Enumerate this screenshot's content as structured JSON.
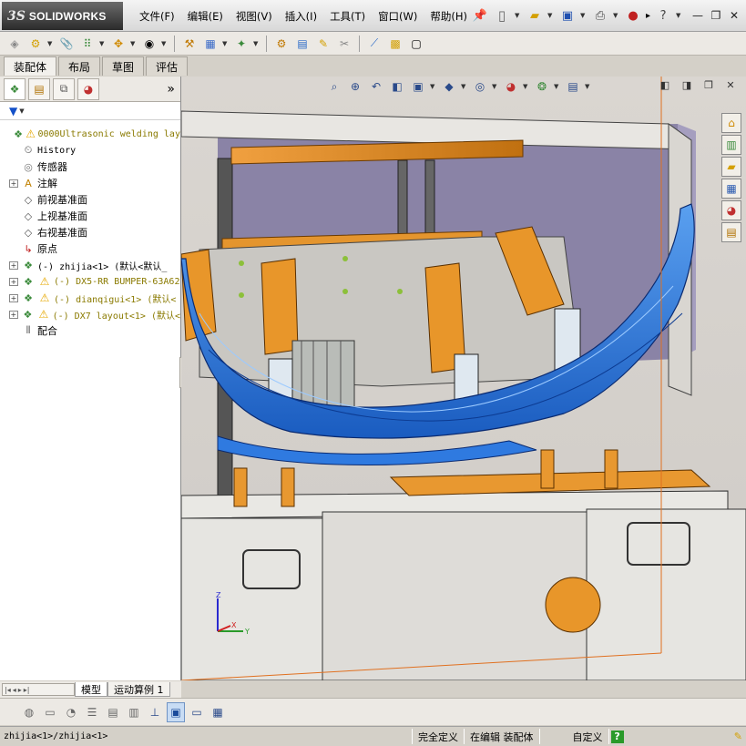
{
  "app": {
    "logo_prefix": "3S",
    "logo_name": "SOLIDWORKS"
  },
  "menu": [
    {
      "label": "文件(F)"
    },
    {
      "label": "编辑(E)"
    },
    {
      "label": "视图(V)"
    },
    {
      "label": "插入(I)"
    },
    {
      "label": "工具(T)"
    },
    {
      "label": "窗口(W)"
    },
    {
      "label": "帮助(H)"
    }
  ],
  "quick_access": {
    "more": "▸",
    "help": "?"
  },
  "window_buttons": {
    "minimize": "—",
    "restore": "❐",
    "close": "✕"
  },
  "command_manager_tabs": [
    {
      "label": "装配体",
      "active": true
    },
    {
      "label": "布局",
      "active": false
    },
    {
      "label": "草图",
      "active": false
    },
    {
      "label": "评估",
      "active": false
    }
  ],
  "feature_tree": {
    "expand_label": "»",
    "filter_icon": "filter-icon",
    "nodes": [
      {
        "expand": false,
        "icon": "assembly-warning",
        "label": "0000Ultrasonic welding lay",
        "style": "olive-mono"
      },
      {
        "expand": false,
        "icon": "history",
        "label": "History",
        "style": "mono"
      },
      {
        "expand": false,
        "icon": "sensor",
        "label": "传感器",
        "style": ""
      },
      {
        "expand": true,
        "icon": "annotation",
        "label": "注解",
        "style": ""
      },
      {
        "expand": false,
        "icon": "plane",
        "label": "前视基准面",
        "style": ""
      },
      {
        "expand": false,
        "icon": "plane",
        "label": "上视基准面",
        "style": ""
      },
      {
        "expand": false,
        "icon": "plane",
        "label": "右视基准面",
        "style": ""
      },
      {
        "expand": false,
        "icon": "origin",
        "label": "原点",
        "style": ""
      },
      {
        "expand": true,
        "icon": "subassembly",
        "label": "(-) zhijia<1> (默认<默认_",
        "style": "mono"
      },
      {
        "expand": true,
        "icon": "subassembly-warning",
        "label": "(-) DX5-RR BUMPER-63A62",
        "style": "olive-mono"
      },
      {
        "expand": true,
        "icon": "subassembly-warning",
        "label": "(-) dianqigui<1> (默认<",
        "style": "olive-mono"
      },
      {
        "expand": true,
        "icon": "subassembly-warning",
        "label": "(-) DX7 layout<1> (默认<",
        "style": "olive-mono"
      },
      {
        "expand": false,
        "icon": "mates",
        "label": "配合",
        "style": ""
      }
    ]
  },
  "bottom_tabs": [
    {
      "label": "模型",
      "active": true
    },
    {
      "label": "运动算例 1",
      "active": false
    }
  ],
  "status_bar": {
    "path": "zhijia<1>/zhijia<1>",
    "definition": "完全定义",
    "mode": "在编辑 装配体",
    "units": "自定义",
    "help": "?"
  },
  "triad": {
    "x": "X",
    "y": "Y",
    "z": "Z"
  },
  "colors": {
    "bumper": "#2e7de0",
    "frame": "#d98a1e",
    "background_top": "#d7d3ce",
    "panel": "#ece9e4"
  }
}
